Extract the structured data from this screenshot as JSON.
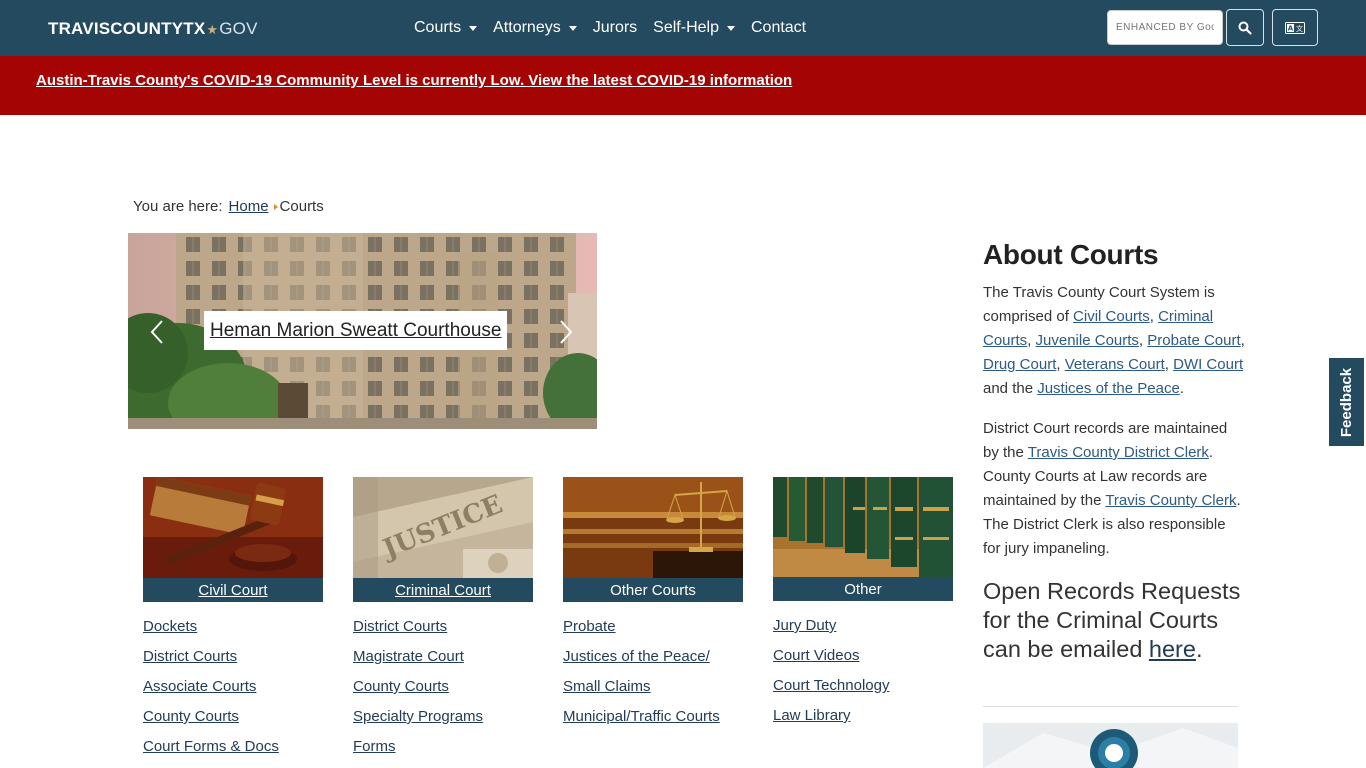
{
  "brand": {
    "part1": "TRAVISCOUNTYTX",
    "star": "★",
    "part2": "GOV"
  },
  "nav": {
    "items": [
      {
        "label": "Courts",
        "dropdown": true
      },
      {
        "label": "Attorneys",
        "dropdown": true
      },
      {
        "label": "Jurors",
        "dropdown": false
      },
      {
        "label": "Self-Help",
        "dropdown": true
      },
      {
        "label": "Contact",
        "dropdown": false
      }
    ],
    "search_placeholder": "ENHANCED BY Google",
    "search_icon": "search-icon",
    "translate_icon": "translate-icon"
  },
  "alert": {
    "text": "Austin-Travis County's COVID-19 Community Level is currently Low. View the latest COVID-19 information"
  },
  "breadcrumb": {
    "prefix": "You are here:",
    "home": "Home",
    "current": "Courts"
  },
  "carousel": {
    "caption": "Heman Marion Sweatt Courthouse"
  },
  "cards": [
    {
      "label": "Civil Court",
      "links": [
        "Dockets",
        "District Courts",
        "Associate Courts",
        "County Courts",
        "Court Forms & Docs"
      ]
    },
    {
      "label": "Criminal Court",
      "links": [
        "District Courts",
        "Magistrate Court",
        "County Courts",
        "Specialty Programs",
        "Forms"
      ]
    },
    {
      "label": "Other Courts",
      "links": [
        "Probate",
        "Justices of the Peace/",
        "Small Claims",
        "Municipal/Traffic Courts"
      ]
    },
    {
      "label": "Other",
      "links": [
        "Jury Duty",
        "Court Videos",
        "Court Technology",
        "Law Library"
      ]
    }
  ],
  "sidebar": {
    "title": "About Courts",
    "p1": {
      "t1": "The Travis County Court System is comprised of ",
      "l1": "Civil Courts",
      "s1": ", ",
      "l2": "Criminal Courts",
      "s2": ", ",
      "l3": "Juvenile Courts",
      "s3": ", ",
      "l4": "Probate Court",
      "s4": ", ",
      "l5": "Drug Court",
      "s5": ", ",
      "l6": "Veterans Court",
      "s6": ", ",
      "l7": "DWI Court",
      "s7": " and the ",
      "l8": "Justices of the Peace",
      "s8": "."
    },
    "p2": {
      "t1": "District Court records are maintained by the ",
      "l1": "Travis County District Clerk",
      "t2": ". County Courts at Law records are maintained by the ",
      "l2": "Travis County Clerk",
      "t3": ". The District Clerk is also responsible for jury impaneling."
    },
    "open_records": {
      "text": "Open Records Requests for the Criminal Courts can be emailed ",
      "link": "here",
      "end": "."
    }
  },
  "feedback": {
    "label": "Feedback"
  }
}
